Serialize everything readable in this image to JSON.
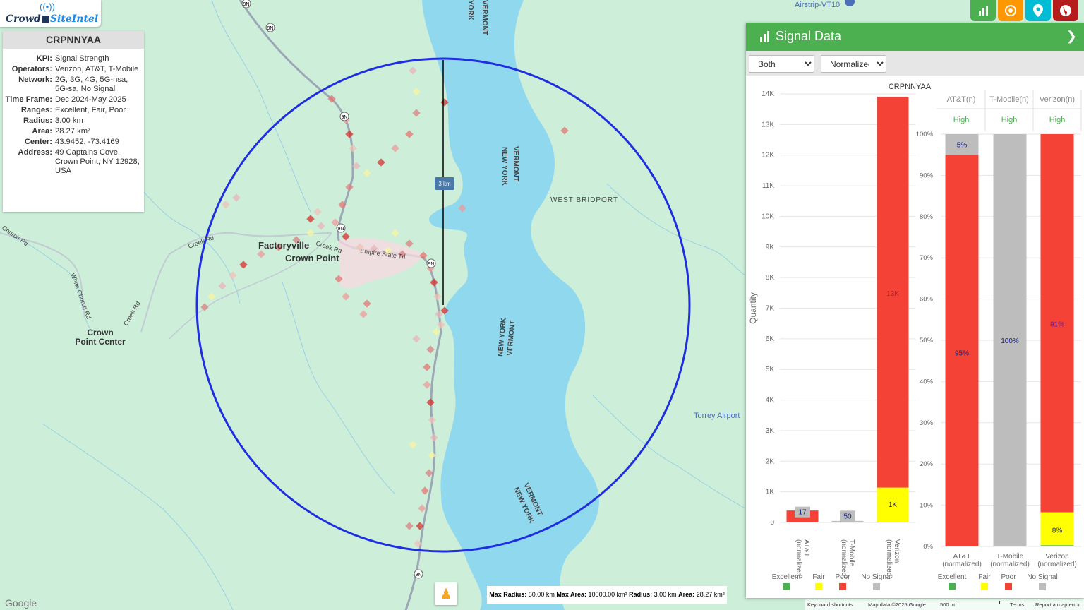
{
  "logo": {
    "brand": "Crowd",
    "brand2": "SiteIntel"
  },
  "info": {
    "title": "CRPNNYAA",
    "rows": [
      {
        "k": "KPI:",
        "v": "Signal Strength"
      },
      {
        "k": "Operators:",
        "v": "Verizon, AT&T, T-Mobile"
      },
      {
        "k": "Network:",
        "v": "2G, 3G, 4G, 5G-nsa, 5G-sa, No Signal"
      },
      {
        "k": "Time Frame:",
        "v": "Dec 2024-May 2025"
      },
      {
        "k": "Ranges:",
        "v": "Excellent, Fair, Poor"
      },
      {
        "k": "Radius:",
        "v": "3.00 km"
      },
      {
        "k": "Area:",
        "v": "28.27 km²"
      },
      {
        "k": "Center:",
        "v": "43.9452, -73.4169"
      },
      {
        "k": "Address:",
        "v": "49 Captains Cove, Crown Point, NY 12928, USA"
      }
    ]
  },
  "map": {
    "labels": {
      "factoryville": "Factoryville",
      "crown_point": "Crown Point",
      "crown_point_center_1": "Crown",
      "crown_point_center_2": "Point Center",
      "west_bridport": "WEST BRIDPORT",
      "torrey": "Torrey Airport",
      "airstrip": "Airstrip-VT10",
      "ny1": "NEW YORK",
      "vt1": "VERMONT",
      "ny2": "NEW YORK",
      "vt2": "VERMONT",
      "ny3": "NEW YORK",
      "vt3": "VERMONT",
      "york_top": "YORK",
      "vont_top": "VERMONT",
      "empire": "Empire State Trl",
      "creek1": "Creek Rd",
      "creek2": "Creek Rd",
      "creek3": "Creek Rd",
      "church": "Church Rd",
      "white_church": "White Church Rd",
      "route": "9N",
      "scale": "3 km",
      "google": "Google"
    },
    "bottom": {
      "max_radius_label": "Max Radius:",
      "max_radius": "50.00 km",
      "max_area_label": "Max Area:",
      "max_area": "10000.00 km²",
      "radius_label": "Radius:",
      "radius": "3.00 km",
      "area_label": "Area:",
      "area": "28.27 km²"
    },
    "footer": {
      "shortcuts": "Keyboard shortcuts",
      "mapdata": "Map data ©2025 Google",
      "scale": "500 m",
      "terms": "Terms",
      "report": "Report a map error"
    }
  },
  "toolbar": {
    "colors": [
      "#4caf50",
      "#ff9800",
      "#00bcd4",
      "#b71c1c"
    ],
    "icons": [
      "bar-chart-icon",
      "target-icon",
      "map-pin-icon",
      "globe-icon"
    ]
  },
  "panel": {
    "title": "Signal Data",
    "select_op": "Both",
    "select_mode": "Normalized",
    "chart_title": "CRPNNYAA",
    "colors": {
      "excellent": "#4caf50",
      "fair": "#ffff00",
      "poor": "#f44336",
      "nosignal": "#bdbdbd"
    },
    "legend": [
      "Excellent",
      "Fair",
      "Poor",
      "No Signal"
    ],
    "table": {
      "headers": [
        "AT&T(n)",
        "T-Mobile(n)",
        "Verizon(n)"
      ],
      "values": [
        "High",
        "High",
        "High"
      ]
    }
  },
  "chart_data": [
    {
      "type": "bar",
      "title": "CRPNNYAA",
      "ylabel": "Quantity",
      "categories": [
        "AT&T (normalized)",
        "T-Mobile (normalized)",
        "Verizon (normalized)"
      ],
      "yticks": [
        "0",
        "1K",
        "2K",
        "3K",
        "4K",
        "5K",
        "6K",
        "7K",
        "8K",
        "9K",
        "10K",
        "11K",
        "12K",
        "13K",
        "14K"
      ],
      "ylim": [
        0,
        14000
      ],
      "series": [
        {
          "name": "Excellent",
          "values": [
            0,
            0,
            10
          ]
        },
        {
          "name": "Fair",
          "values": [
            0,
            0,
            1130
          ]
        },
        {
          "name": "Poor",
          "values": [
            390,
            0,
            12770
          ]
        },
        {
          "name": "No Signal",
          "values": [
            17,
            50,
            0
          ]
        }
      ],
      "labels": [
        {
          "cat": 0,
          "text": "17"
        },
        {
          "cat": 1,
          "text": "50"
        },
        {
          "cat": 2,
          "text": "1K"
        },
        {
          "cat": 2,
          "text": "13K"
        }
      ]
    },
    {
      "type": "bar",
      "stacked_percent": true,
      "categories": [
        "AT&T (normalized)",
        "T-Mobile (normalized)",
        "Verizon (normalized)"
      ],
      "yticks": [
        "0%",
        "10%",
        "20%",
        "30%",
        "40%",
        "50%",
        "60%",
        "70%",
        "80%",
        "90%",
        "100%"
      ],
      "ylim": [
        0,
        100
      ],
      "series": [
        {
          "name": "Excellent",
          "values": [
            0,
            0,
            0.3
          ]
        },
        {
          "name": "Fair",
          "values": [
            0,
            0,
            8
          ]
        },
        {
          "name": "Poor",
          "values": [
            95,
            0,
            91.7
          ]
        },
        {
          "name": "No Signal",
          "values": [
            5,
            100,
            0
          ]
        }
      ],
      "labels": [
        {
          "cat": 0,
          "series": "No Signal",
          "text": "5%"
        },
        {
          "cat": 0,
          "series": "Poor",
          "text": "95%"
        },
        {
          "cat": 1,
          "series": "No Signal",
          "text": "100%"
        },
        {
          "cat": 2,
          "series": "Poor",
          "text": "91%"
        },
        {
          "cat": 2,
          "series": "Fair",
          "text": "8%"
        }
      ]
    }
  ]
}
